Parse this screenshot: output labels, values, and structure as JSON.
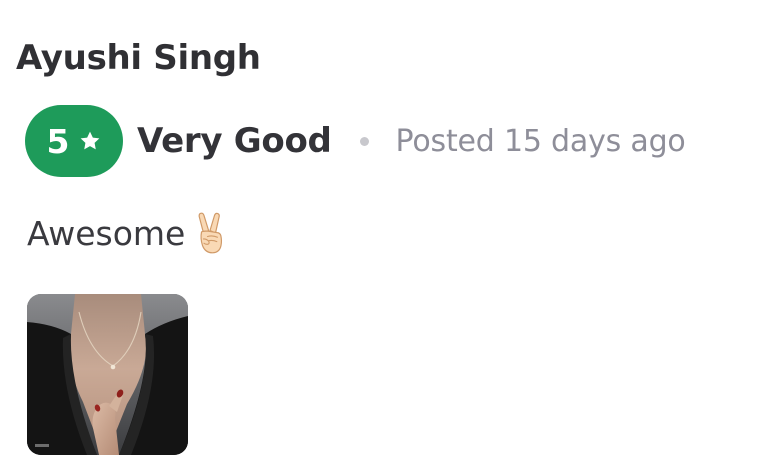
{
  "review": {
    "reviewer_name": "Ayushi Singh",
    "rating": {
      "value": "5",
      "label": "Very Good",
      "icon": "star-icon",
      "color": "#1e9b5a"
    },
    "posted": "Posted 15 days ago",
    "text": "Awesome",
    "emoji": "victory-hand-icon",
    "photo": {
      "icon": "necklace-photo",
      "count": 1
    }
  }
}
